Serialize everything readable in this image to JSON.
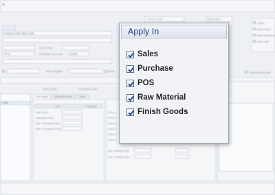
{
  "popup": {
    "title": "Apply In",
    "options": [
      {
        "label": "Sales",
        "checked": true
      },
      {
        "label": "Purchase",
        "checked": true
      },
      {
        "label": "POS",
        "checked": true
      },
      {
        "label": "Raw Material",
        "checked": true
      },
      {
        "label": "Finish Goods",
        "checked": true
      }
    ]
  },
  "background": {
    "field_labels": [
      "Lead Time",
      "Purchase Tax Code",
      "Main Supplier",
      "Sales UOM",
      "Purchase UOM",
      "Stock"
    ],
    "field_values": [
      "CHAIN CORD MACHINE",
      "TP-8",
      "KEMP"
    ],
    "header_fields": [
      "Invoice Cost",
      "Aging Item"
    ],
    "right_options": [
      "Active",
      "Not Printed",
      "Miscellaneous",
      "Auto Infill"
    ],
    "tabs": [
      "Unit Details",
      "Alternative Units",
      "Other"
    ],
    "grid_headers": [
      "Unit",
      "Package"
    ],
    "grid_rows": [
      "Unit Cost",
      "Standard Cost",
      "Min. Purchase Price",
      "Max. Purchase Price"
    ],
    "price_labels": [
      "Price 1",
      "Price 2",
      "Price 3",
      "Price 4",
      "Price 5",
      "Price 6",
      "Min. Selling Price",
      "Max. Selling Price"
    ],
    "tree_root": "Units",
    "calc_label": "Calculate Reorder"
  }
}
